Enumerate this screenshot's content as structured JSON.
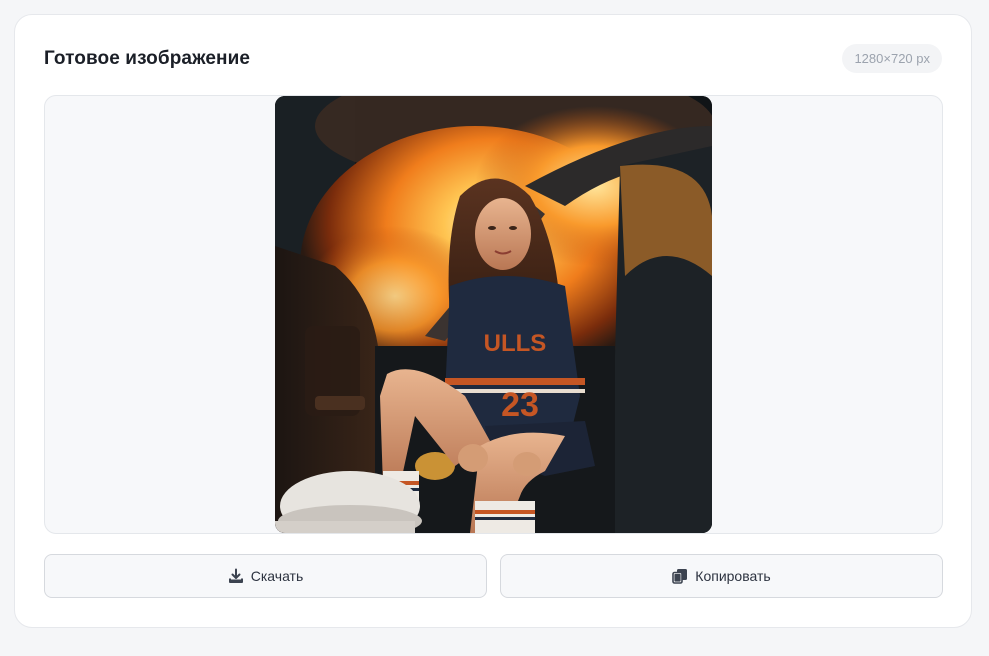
{
  "panel": {
    "title": "Готовое изображение",
    "dimensions_badge": "1280×720 px"
  },
  "preview": {
    "image_alt": "Generated image: a young woman with long brown hair in a navy and orange basketball jersey, sitting in the open door of a car with fire and smoke behind her"
  },
  "actions": {
    "download_label": "Скачать",
    "download_icon": "download-icon",
    "copy_label": "Копировать",
    "copy_icon": "copy-icon"
  },
  "colors": {
    "title": "#1b1f27",
    "badge_bg": "#f3f4f6",
    "badge_text": "#9ca3ae",
    "button_bg": "#f7f8fa",
    "button_border": "#d6d9de",
    "button_text": "#2d3340"
  }
}
